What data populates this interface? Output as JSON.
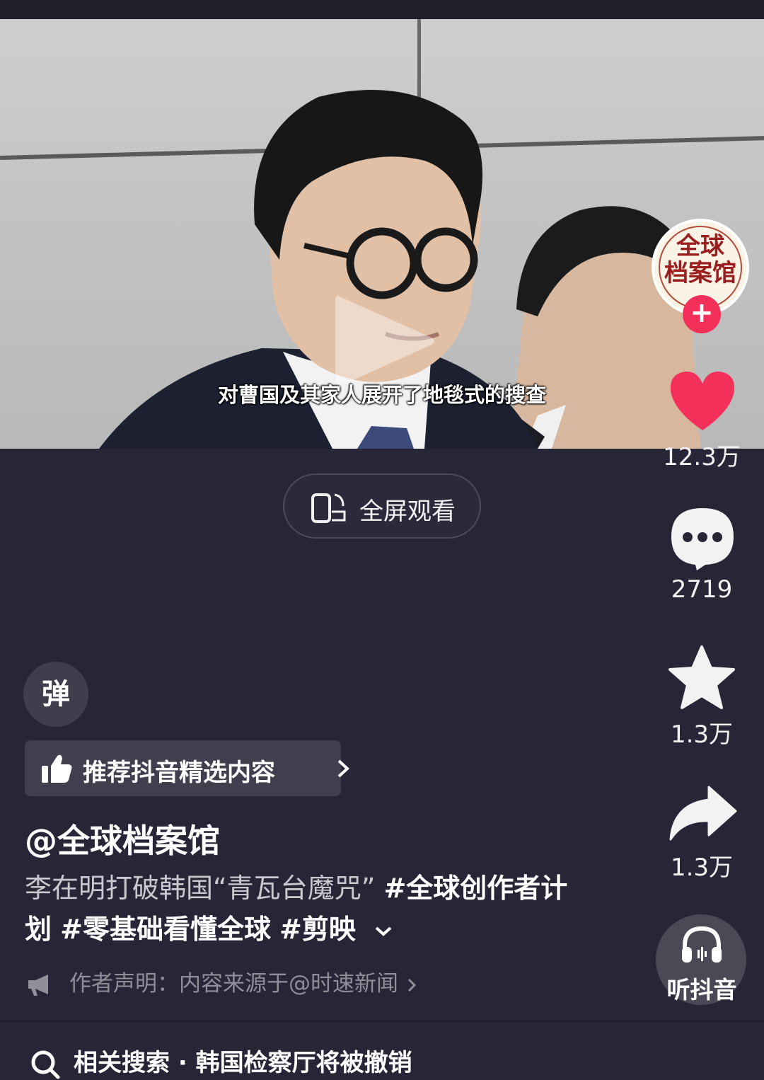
{
  "video": {
    "subtitle": "对曹国及其家人展开了地毯式的搜查"
  },
  "rail": {
    "avatar_text_line1": "全球",
    "avatar_text_line2": "档案馆",
    "follow_symbol": "+",
    "likes": "12.3万",
    "comments": "2719",
    "favorites": "1.3万",
    "shares": "1.3万",
    "listen_label": "听抖音"
  },
  "center": {
    "fullscreen_label": "全屏观看"
  },
  "info": {
    "danmu_label": "弹",
    "recommend_label": "推荐抖音精选内容",
    "author": "@全球档案馆",
    "desc_text": "李在明打破韩国“青瓦台魔咒” ",
    "tag1": "#全球创作者计划",
    "tag2": "#零基础看懂全球",
    "tag3": "#剪映",
    "declare_label": "作者声明：内容来源于@时速新闻",
    "related_search": "相关搜索 · 韩国检察厅将被撤销"
  },
  "colors": {
    "background": "#262637",
    "like_red": "#f2305a",
    "follow_red": "#f2305a"
  },
  "icons": [
    "play-icon",
    "plus-icon",
    "heart-icon",
    "comment-icon",
    "star-icon",
    "share-icon",
    "headphones-icon",
    "rotate-phone-icon",
    "thumbs-up-icon",
    "chevron-right-icon",
    "chevron-down-icon",
    "megaphone-icon",
    "search-icon"
  ]
}
